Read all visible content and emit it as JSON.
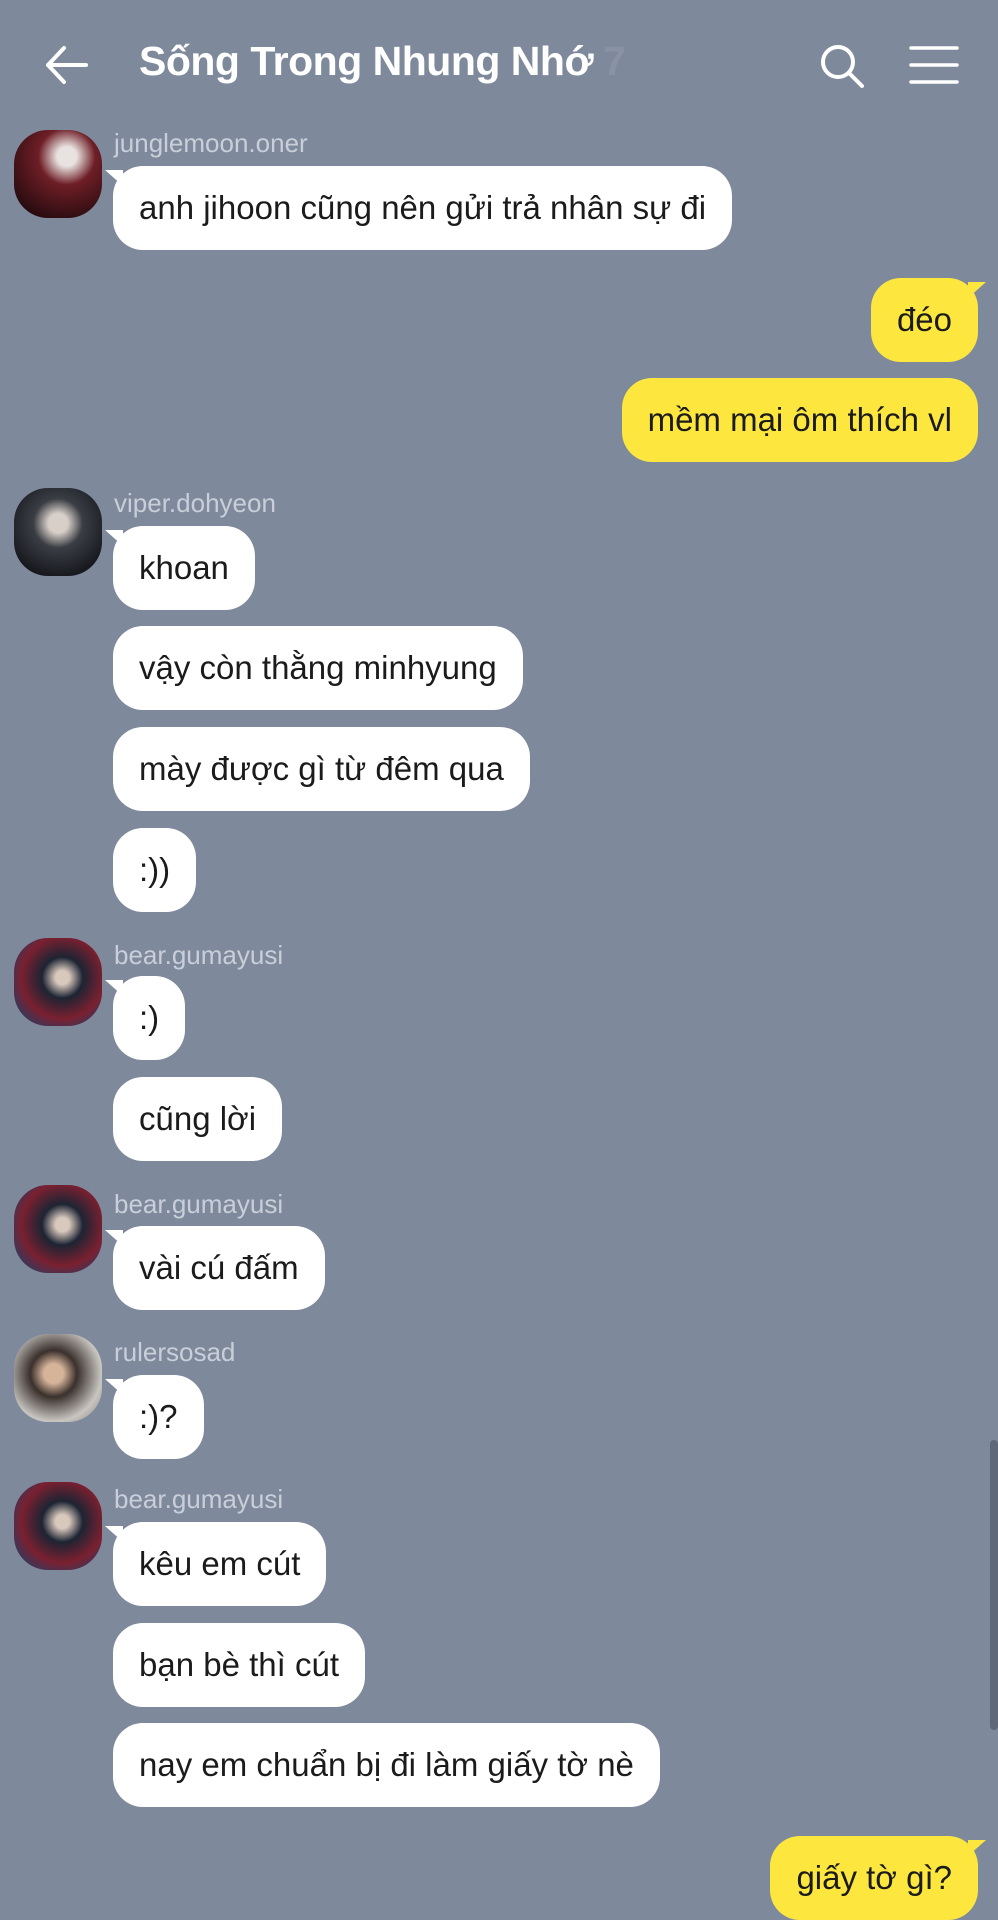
{
  "header": {
    "title": "Sống Trong Nhung Nhớ",
    "member_count": "7"
  },
  "colors": {
    "background": "#7f899c",
    "incoming_bubble": "#ffffff",
    "outgoing_bubble": "#fde73f",
    "sender_name": "#c9cfd9"
  },
  "icons": {
    "back": "arrow-left-icon",
    "search": "search-icon",
    "menu": "hamburger-menu-icon"
  },
  "messages": [
    {
      "sender": "junglemoon.oner",
      "text": "anh jihoon cũng nên gửi trả nhân sự đi"
    },
    {
      "sender": "me",
      "text": "đéo"
    },
    {
      "sender": "me",
      "text": "mềm mại ôm thích vl"
    },
    {
      "sender": "viper.dohyeon",
      "text": "khoan"
    },
    {
      "sender": "viper.dohyeon",
      "text": "vậy còn thằng minhyung"
    },
    {
      "sender": "viper.dohyeon",
      "text": "mày được gì từ đêm qua"
    },
    {
      "sender": "viper.dohyeon",
      "text": ":))"
    },
    {
      "sender": "bear.gumayusi",
      "text": ":)"
    },
    {
      "sender": "bear.gumayusi",
      "text": "cũng lời"
    },
    {
      "sender": "bear.gumayusi",
      "text": "vài cú đấm"
    },
    {
      "sender": "rulersosad",
      "text": ":)?"
    },
    {
      "sender": "bear.gumayusi",
      "text": "kêu em cút"
    },
    {
      "sender": "bear.gumayusi",
      "text": "bạn bè thì cút"
    },
    {
      "sender": "bear.gumayusi",
      "text": "nay em chuẩn bị đi làm giấy tờ nè"
    },
    {
      "sender": "me",
      "text": "giấy tờ gì?"
    }
  ]
}
